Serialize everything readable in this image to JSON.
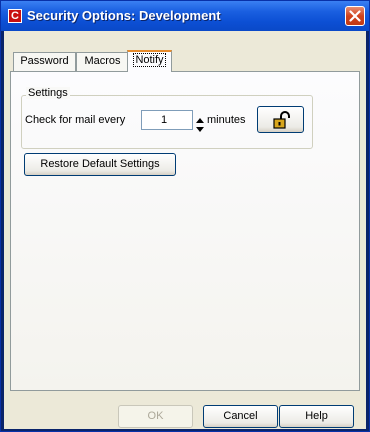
{
  "window": {
    "title": "Security Options:  Development",
    "app_icon_glyph": "C",
    "app_icon_name": "app-icon",
    "close_icon_name": "close-icon"
  },
  "tabs": [
    {
      "label": "Password",
      "active": false
    },
    {
      "label": "Macros",
      "active": false
    },
    {
      "label": "Notify",
      "active": true
    }
  ],
  "settings": {
    "group_label": "Settings",
    "check_label": "Check for mail every",
    "interval_value": "1",
    "minutes_label": "minutes",
    "lock_icon_name": "unlocked-padlock-icon"
  },
  "restore_button_label": "Restore Default Settings",
  "footer": {
    "ok_label": "OK",
    "ok_enabled": false,
    "cancel_label": "Cancel",
    "help_label": "Help"
  },
  "colors": {
    "titlebar": "#0c4fd4",
    "close_button": "#d0421d",
    "dialog_bg": "#ece9d8",
    "active_tab_accent": "#e68b2c",
    "lock_accent": "#d7a51c"
  }
}
